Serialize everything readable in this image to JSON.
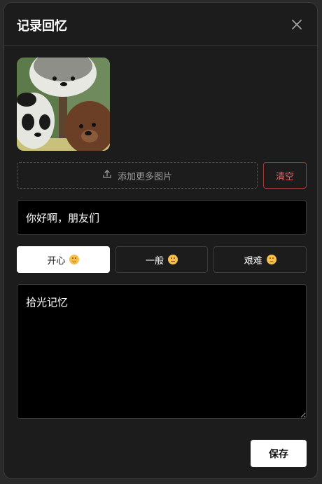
{
  "dialog": {
    "title": "记录回忆"
  },
  "images": {
    "add_more_label": "添加更多图片",
    "clear_label": "清空"
  },
  "title_field": {
    "value": "你好啊，朋友们"
  },
  "moods": [
    {
      "label": "开心",
      "icon": "happy-emoji-icon",
      "selected": true
    },
    {
      "label": "一般",
      "icon": "neutral-emoji-icon",
      "selected": false
    },
    {
      "label": "艰难",
      "icon": "sad-emoji-icon",
      "selected": false
    }
  ],
  "memo_field": {
    "value": "拾光记忆"
  },
  "actions": {
    "save_label": "保存"
  },
  "colors": {
    "danger": "#e26a6a",
    "surface": "#1c1c1c",
    "input_bg": "#000000"
  }
}
